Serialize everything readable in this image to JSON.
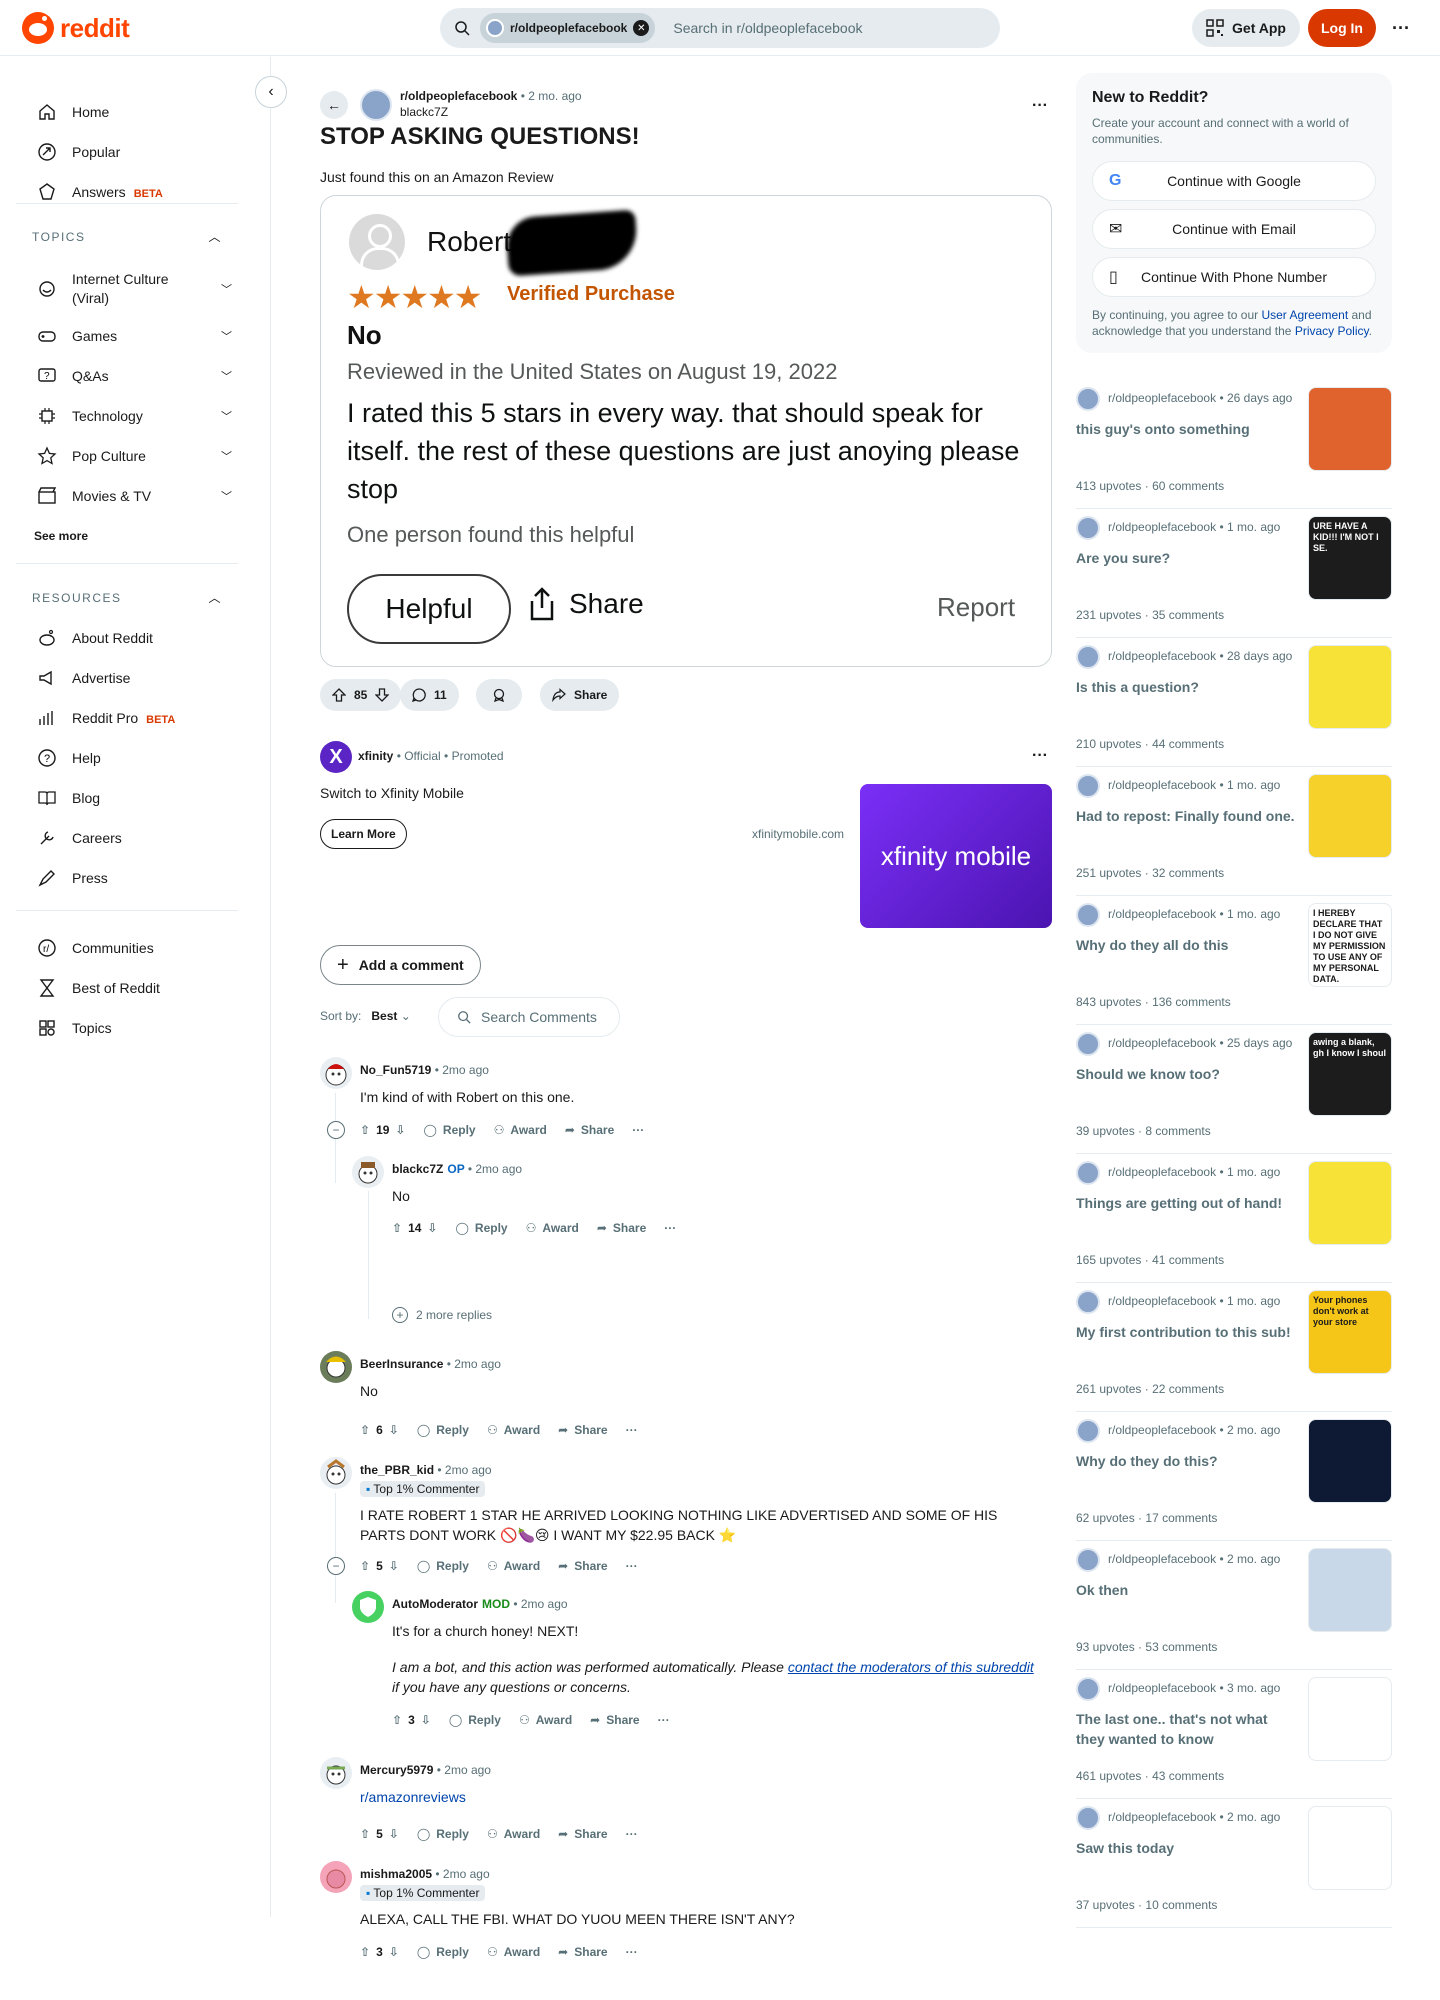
{
  "header": {
    "logo_text": "reddit",
    "search_chip": "r/oldpeoplefacebook",
    "search_placeholder": "Search in r/oldpeoplefacebook",
    "get_app": "Get App",
    "login": "Log In"
  },
  "sidebar": {
    "main": [
      {
        "label": "Home",
        "icon": "home-icon"
      },
      {
        "label": "Popular",
        "icon": "popular-icon"
      },
      {
        "label": "Answers",
        "icon": "answers-icon",
        "badge": "BETA"
      }
    ],
    "topics_title": "TOPICS",
    "topics": [
      {
        "label": "Internet Culture\n(Viral)",
        "icon": "internet-culture-icon"
      },
      {
        "label": "Games",
        "icon": "games-icon"
      },
      {
        "label": "Q&As",
        "icon": "qa-icon"
      },
      {
        "label": "Technology",
        "icon": "technology-icon"
      },
      {
        "label": "Pop Culture",
        "icon": "pop-culture-icon"
      },
      {
        "label": "Movies & TV",
        "icon": "movies-icon"
      }
    ],
    "see_more": "See more",
    "resources_title": "RESOURCES",
    "resources": [
      {
        "label": "About Reddit",
        "icon": "about-icon"
      },
      {
        "label": "Advertise",
        "icon": "advertise-icon"
      },
      {
        "label": "Reddit Pro",
        "icon": "pro-icon",
        "badge": "BETA"
      },
      {
        "label": "Help",
        "icon": "help-icon"
      },
      {
        "label": "Blog",
        "icon": "blog-icon"
      },
      {
        "label": "Careers",
        "icon": "careers-icon"
      },
      {
        "label": "Press",
        "icon": "press-icon"
      }
    ],
    "footer": [
      {
        "label": "Communities",
        "icon": "communities-icon"
      },
      {
        "label": "Best of Reddit",
        "icon": "best-of-icon"
      },
      {
        "label": "Topics",
        "icon": "topics-icon"
      }
    ]
  },
  "post": {
    "subreddit": "r/oldpeoplefacebook",
    "age": "• 2 mo. ago",
    "author": "blackc7Z",
    "title": "STOP ASKING QUESTIONS!",
    "body": "Just found this on an Amazon Review",
    "review": {
      "name": "Robert Ba",
      "stars": "★★★★★",
      "verified": "Verified Purchase",
      "headline": "No",
      "date": "Reviewed in the United States on August 19, 2022",
      "text": "I rated this 5 stars in every way. that should speak for itself. the rest of these questions are just anoying please stop",
      "helpful_count": "One person found this helpful",
      "helpful_btn": "Helpful",
      "share": "Share",
      "report": "Report"
    },
    "upvotes": "85",
    "comments": "11",
    "share": "Share"
  },
  "ad": {
    "avatar_letter": "X",
    "name": "xfinity",
    "official": "• Official",
    "promoted": "• Promoted",
    "text": "Switch to Xfinity Mobile",
    "cta": "Learn More",
    "domain": "xfinitymobile.com",
    "image_text": "xfinity mobile"
  },
  "comments_bar": {
    "add_comment": "Add a comment",
    "sort_label": "Sort by:",
    "sort_value": "Best",
    "search_placeholder": "Search Comments"
  },
  "comments": [
    {
      "author": "No_Fun5719",
      "age": "• 2mo ago",
      "text": "I'm kind of with Robert on this one.",
      "votes": "19"
    },
    {
      "author": "blackc7Z",
      "tag": "OP",
      "age": "• 2mo ago",
      "text": "No",
      "votes": "14",
      "more_replies": "2 more replies"
    },
    {
      "author": "BeerInsurance",
      "age": "• 2mo ago",
      "text": "No",
      "votes": "6"
    },
    {
      "author": "the_PBR_kid",
      "age": "• 2mo ago",
      "flair": "Top 1% Commenter",
      "text": "I RATE ROBERT 1 STAR HE ARRIVED LOOKING NOTHING LIKE ADVERTISED AND SOME OF HIS PARTS DONT WORK 🚫🍆😢 I WANT MY $22.95 BACK ⭐",
      "votes": "5"
    },
    {
      "author": "AutoModerator",
      "tag": "MOD",
      "age": "• 2mo ago",
      "text": "It's for a church honey! NEXT!",
      "bot_pre": "I am a bot, and this action was performed automatically. Please ",
      "bot_link": "contact the moderators of this subreddit",
      "bot_post": " if you have any questions or concerns.",
      "votes": "3"
    },
    {
      "author": "Mercury5979",
      "age": "• 2mo ago",
      "text": "r/amazonreviews",
      "votes": "5"
    },
    {
      "author": "mishma2005",
      "age": "• 2mo ago",
      "flair": "Top 1% Commenter",
      "text": "ALEXA, CALL THE FBI. WHAT DO YUOU MEEN THERE ISN'T ANY?",
      "votes": "3"
    }
  ],
  "actions": {
    "reply": "Reply",
    "award": "Award",
    "share": "Share"
  },
  "right": {
    "new_title": "New to Reddit?",
    "new_desc": "Create your account and connect with a world of communities.",
    "google": "Continue with Google",
    "email": "Continue with Email",
    "phone": "Continue With Phone Number",
    "legal_pre": "By continuing, you agree to our ",
    "legal_link1": "User Agreement",
    "legal_mid": " and acknowledge that you understand the ",
    "legal_link2": "Privacy Policy",
    "legal_post": ".",
    "posts": [
      {
        "sub": "r/oldpeoplefacebook",
        "age": "• 26 days ago",
        "title": "this guy's onto something",
        "upvotes": "413 upvotes",
        "comments": "60 comments",
        "thumb": "#e0632d"
      },
      {
        "sub": "r/oldpeoplefacebook",
        "age": "• 1 mo. ago",
        "title": "Are you sure?",
        "upvotes": "231 upvotes",
        "comments": "35 comments",
        "thumb": "#1c1c1c",
        "thumb_text": "URE HAVE A KID!!! I'M NOT I SE."
      },
      {
        "sub": "r/oldpeoplefacebook",
        "age": "• 28 days ago",
        "title": "Is this a question?",
        "upvotes": "210 upvotes",
        "comments": "44 comments",
        "thumb": "#f7e337"
      },
      {
        "sub": "r/oldpeoplefacebook",
        "age": "• 1 mo. ago",
        "title": "Had to repost: Finally found one.",
        "upvotes": "251 upvotes",
        "comments": "32 comments",
        "thumb": "#f5d12a"
      },
      {
        "sub": "r/oldpeoplefacebook",
        "age": "• 1 mo. ago",
        "title": "Why do they all do this",
        "upvotes": "843 upvotes",
        "comments": "136 comments",
        "thumb": "#ffffff",
        "thumb_text": "I HEREBY DECLARE THAT I DO NOT GIVE MY PERMISSION TO USE ANY OF MY PERSONAL DATA."
      },
      {
        "sub": "r/oldpeoplefacebook",
        "age": "• 25 days ago",
        "title": "Should we know too?",
        "upvotes": "39 upvotes",
        "comments": "8 comments",
        "thumb": "#1c1c1c",
        "thumb_text": "awing a blank, gh I know I shoul"
      },
      {
        "sub": "r/oldpeoplefacebook",
        "age": "• 1 mo. ago",
        "title": "Things are getting out of hand!",
        "upvotes": "165 upvotes",
        "comments": "41 comments",
        "thumb": "#f7e337"
      },
      {
        "sub": "r/oldpeoplefacebook",
        "age": "• 1 mo. ago",
        "title": "My first contribution to this sub!",
        "upvotes": "261 upvotes",
        "comments": "22 comments",
        "thumb": "#f5c518",
        "thumb_text": "Your phones don't work at your store"
      },
      {
        "sub": "r/oldpeoplefacebook",
        "age": "• 2 mo. ago",
        "title": "Why do they do this?",
        "upvotes": "62 upvotes",
        "comments": "17 comments",
        "thumb": "#0e1a33"
      },
      {
        "sub": "r/oldpeoplefacebook",
        "age": "• 2 mo. ago",
        "title": "Ok then",
        "upvotes": "93 upvotes",
        "comments": "53 comments",
        "thumb": "#c9d8e8"
      },
      {
        "sub": "r/oldpeoplefacebook",
        "age": "• 3 mo. ago",
        "title": "The last one.. that's not what they wanted to know",
        "upvotes": "461 upvotes",
        "comments": "43 comments",
        "thumb": "#ffffff"
      },
      {
        "sub": "r/oldpeoplefacebook",
        "age": "• 2 mo. ago",
        "title": "Saw this today",
        "upvotes": "37 upvotes",
        "comments": "10 comments",
        "thumb": "#ffffff"
      }
    ]
  }
}
